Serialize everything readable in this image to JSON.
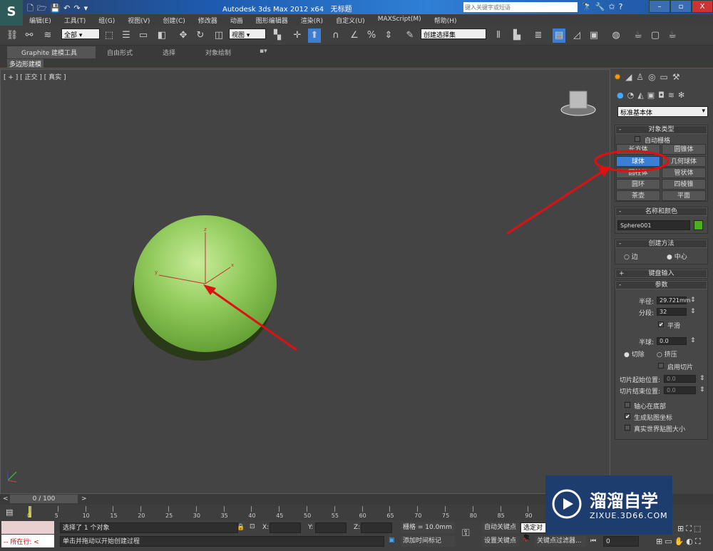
{
  "title_bar": {
    "app_title": "Autodesk 3ds Max  2012 x64",
    "doc_title": "无标题",
    "search_placeholder": "键入关键字或短语",
    "app_icon": "3dsmax-logo-icon"
  },
  "menu": [
    "编辑(E)",
    "工具(T)",
    "组(G)",
    "视图(V)",
    "创建(C)",
    "修改器",
    "动画",
    "图形编辑器",
    "渲染(R)",
    "自定义(U)",
    "MAXScript(M)",
    "帮助(H)"
  ],
  "toolbar": {
    "selection_filter": "全部",
    "reference_coord": "视图",
    "named_selection": "创建选择集"
  },
  "ribbon": {
    "tabs": [
      "Graphite 建模工具",
      "自由形式",
      "选择",
      "对象绘制"
    ],
    "subtab": "多边形建模"
  },
  "viewport": {
    "label": "[ + ] [ 正交 ] [ 真实 ]",
    "axes": {
      "x": "x",
      "y": "y",
      "z": "z"
    }
  },
  "command_panel": {
    "category": "标准基本体",
    "object_type": {
      "title": "对象类型",
      "autogrid": "自动栅格",
      "buttons": [
        "长方体",
        "圆锥体",
        "球体",
        "几何球体",
        "圆柱体",
        "管状体",
        "圆环",
        "四棱锥",
        "茶壶",
        "平面"
      ],
      "active": "球体"
    },
    "name_color": {
      "title": "名称和颜色",
      "name": "Sphere001",
      "color": "#4caf1e"
    },
    "creation_method": {
      "title": "创建方法",
      "options": [
        "边",
        "中心"
      ],
      "selected": "中心"
    },
    "keyboard_entry": {
      "title": "键盘输入"
    },
    "parameters": {
      "title": "参数",
      "radius_label": "半径:",
      "radius": "29.721mm",
      "segments_label": "分段:",
      "segments": "32",
      "smooth": "平滑",
      "smooth_checked": true,
      "hemisphere_label": "半球:",
      "hemisphere": "0.0",
      "chop": "切除",
      "squash": "挤压",
      "hemi_mode": "切除",
      "enable_slice": "启用切片",
      "slice_from_label": "切片起始位置:",
      "slice_from": "0.0",
      "slice_to_label": "切片结束位置:",
      "slice_to": "0.0",
      "base_to_pivot": "轴心在底部",
      "gen_mapping": "生成贴图坐标",
      "gen_mapping_checked": true,
      "real_world": "真实世界贴图大小"
    }
  },
  "timeline": {
    "frame": "0 / 100",
    "ticks": [
      "0",
      "5",
      "10",
      "15",
      "20",
      "25",
      "30",
      "35",
      "40",
      "45",
      "50",
      "55",
      "60",
      "65",
      "70",
      "75",
      "80",
      "85",
      "90"
    ]
  },
  "status": {
    "maxscript_label": "所在行:",
    "selected": "选择了 1 个对象",
    "prompt": "单击并拖动以开始创建过程",
    "x_label": "X:",
    "y_label": "Y:",
    "z_label": "Z:",
    "grid": "栅格 = 10.0mm",
    "add_time_tag": "添加时间标记",
    "auto_key": "自动关键点",
    "selected_mode": "选定对象",
    "set_key": "设置关键点",
    "key_filters": "关键点过滤器...",
    "frame_value": "0"
  },
  "watermark": {
    "brand": "溜溜自学",
    "url": "ZIXUE.3D66.COM"
  },
  "colors": {
    "annotation_red": "#e01010",
    "active_button": "#3a7fd5",
    "sphere": "#8fc95a"
  }
}
